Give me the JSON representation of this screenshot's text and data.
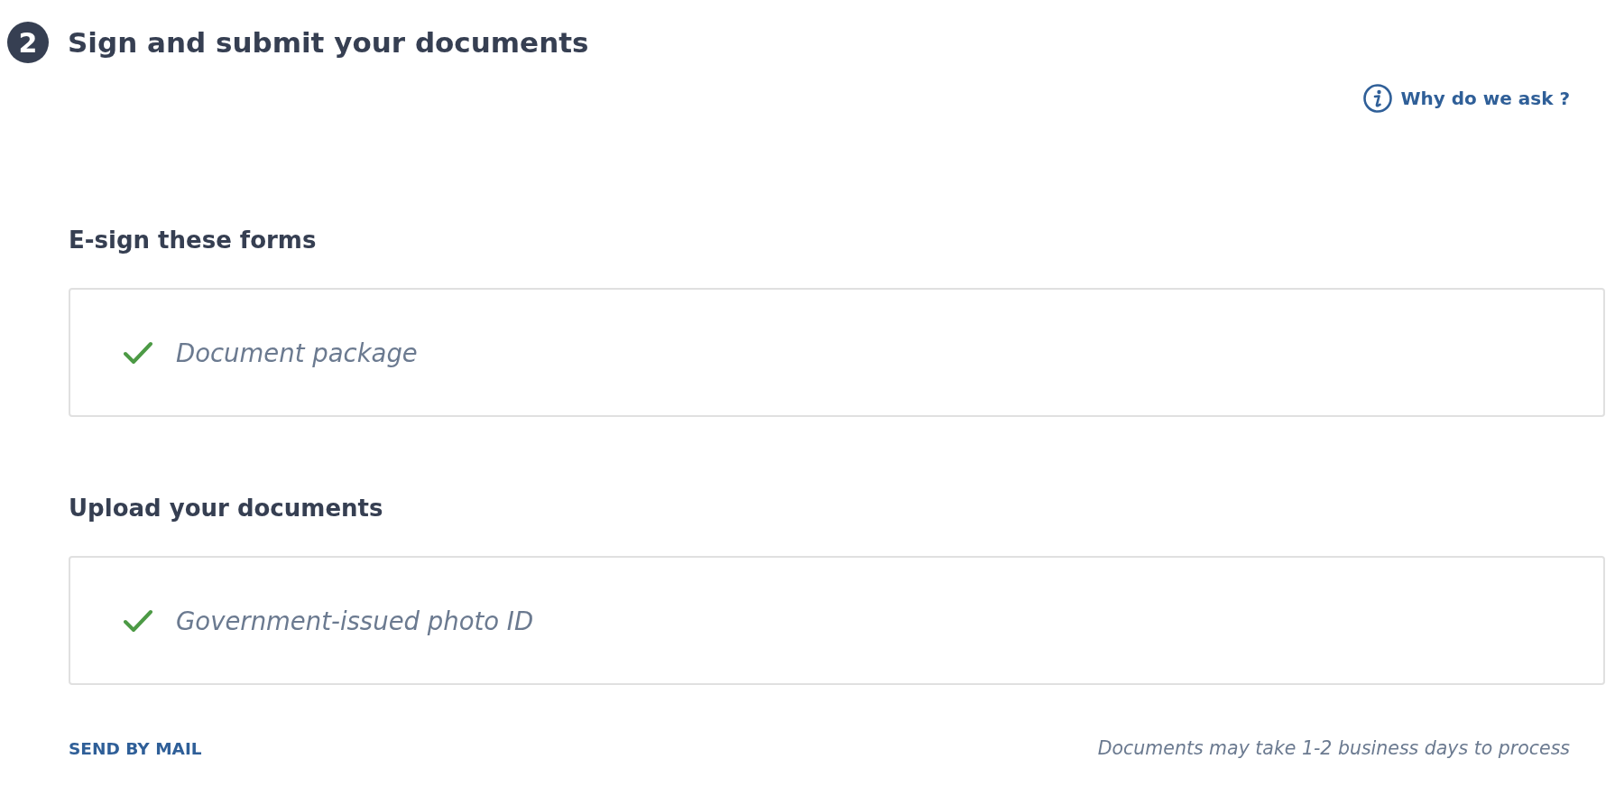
{
  "step": {
    "number": "2",
    "title": "Sign and submit your documents"
  },
  "help_link": {
    "label": "Why do we ask ?"
  },
  "sections": [
    {
      "title": "E-sign these forms",
      "items": [
        {
          "label": "Document package",
          "completed": true
        }
      ]
    },
    {
      "title": "Upload your documents",
      "items": [
        {
          "label": "Government-issued photo ID",
          "completed": true
        }
      ]
    }
  ],
  "footer": {
    "send_by_mail": "SEND BY MAIL",
    "note": "Documents may take 1-2 business days to process"
  }
}
